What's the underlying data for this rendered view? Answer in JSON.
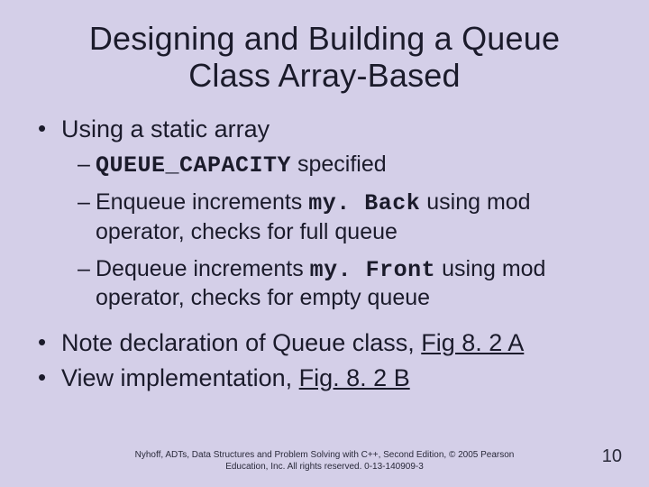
{
  "title_line1": "Designing and Building a Queue",
  "title_line2": "Class   Array-Based",
  "bullets": {
    "b1": "Using a static array",
    "sub1_code": "QUEUE_CAPACITY",
    "sub1_rest": " specified",
    "sub2_a": "Enqueue increments ",
    "sub2_code": "my. Back",
    "sub2_b": " using mod operator, checks for full queue",
    "sub3_a": "Dequeue increments ",
    "sub3_code": "my. Front",
    "sub3_b": " using mod operator, checks for empty queue",
    "b2_a": "Note declaration of Queue class, ",
    "b2_link": "Fig 8. 2 A",
    "b3_a": "View implementation, ",
    "b3_link": "Fig. 8. 2 B"
  },
  "footer_line1": "Nyhoff, ADTs, Data Structures and Problem Solving with C++, Second Edition, © 2005 Pearson",
  "footer_line2": "Education, Inc. All rights reserved. 0-13-140909-3",
  "page_number": "10"
}
